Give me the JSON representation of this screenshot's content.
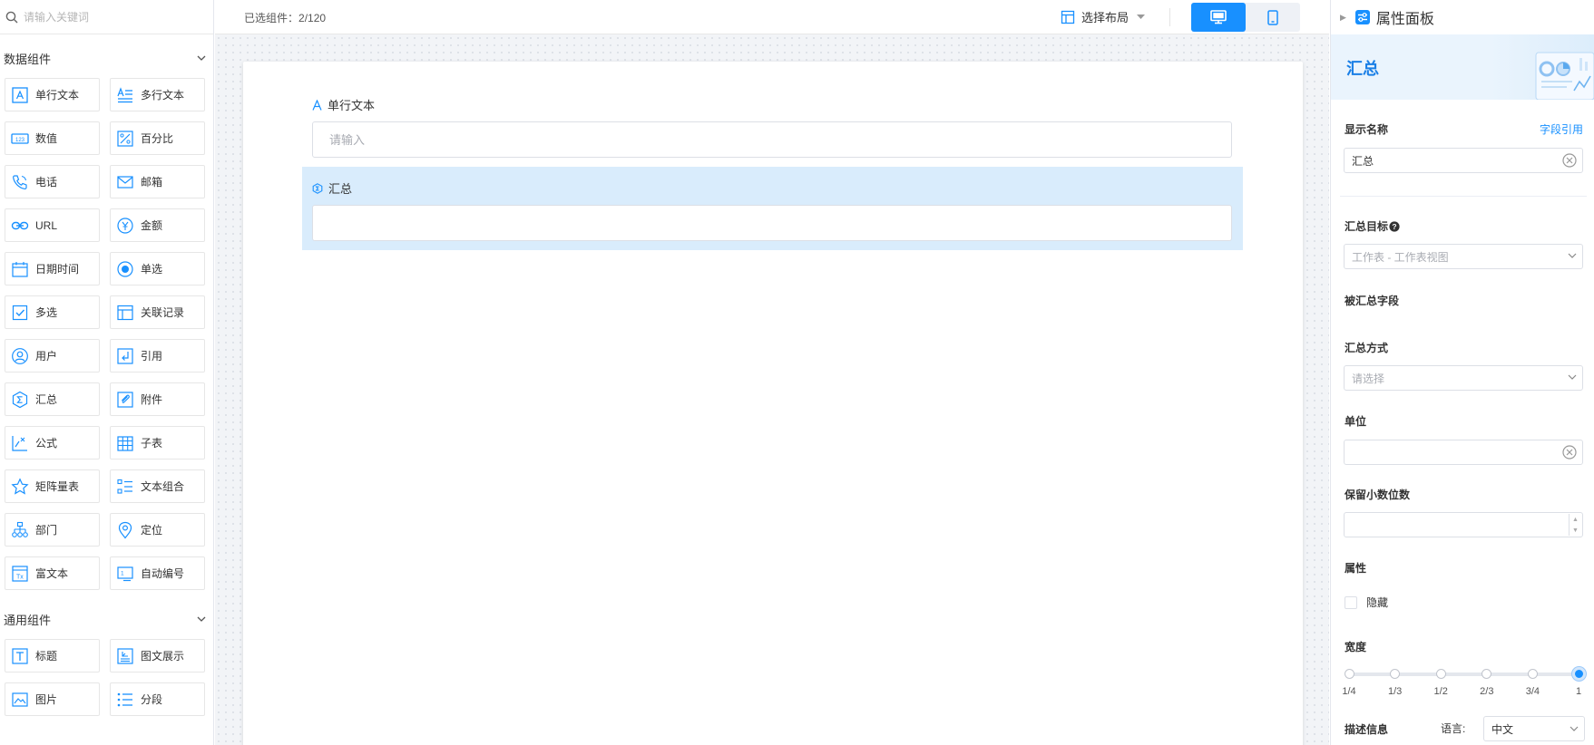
{
  "search": {
    "placeholder": "请输入关键词"
  },
  "groups": {
    "data": {
      "title": "数据组件",
      "items": [
        {
          "label": "单行文本",
          "icon": "single-line-text-icon"
        },
        {
          "label": "多行文本",
          "icon": "multi-line-text-icon"
        },
        {
          "label": "数值",
          "icon": "number-icon"
        },
        {
          "label": "百分比",
          "icon": "percent-icon"
        },
        {
          "label": "电话",
          "icon": "phone-icon"
        },
        {
          "label": "邮箱",
          "icon": "email-icon"
        },
        {
          "label": "URL",
          "icon": "link-icon"
        },
        {
          "label": "金额",
          "icon": "currency-icon"
        },
        {
          "label": "日期时间",
          "icon": "calendar-icon"
        },
        {
          "label": "单选",
          "icon": "radio-icon"
        },
        {
          "label": "多选",
          "icon": "checkbox-icon"
        },
        {
          "label": "关联记录",
          "icon": "relation-icon"
        },
        {
          "label": "用户",
          "icon": "user-icon"
        },
        {
          "label": "引用",
          "icon": "reference-icon"
        },
        {
          "label": "汇总",
          "icon": "summary-icon"
        },
        {
          "label": "附件",
          "icon": "attachment-icon"
        },
        {
          "label": "公式",
          "icon": "formula-icon"
        },
        {
          "label": "子表",
          "icon": "subtable-icon"
        },
        {
          "label": "矩阵量表",
          "icon": "matrix-scale-icon"
        },
        {
          "label": "文本组合",
          "icon": "text-group-icon"
        },
        {
          "label": "部门",
          "icon": "department-icon"
        },
        {
          "label": "定位",
          "icon": "location-icon"
        },
        {
          "label": "富文本",
          "icon": "rich-text-icon"
        },
        {
          "label": "自动编号",
          "icon": "auto-number-icon"
        }
      ]
    },
    "general": {
      "title": "通用组件",
      "items": [
        {
          "label": "标题",
          "icon": "title-icon"
        },
        {
          "label": "图文展示",
          "icon": "image-text-icon"
        },
        {
          "label": "图片",
          "icon": "image-icon"
        },
        {
          "label": "分段",
          "icon": "section-icon"
        }
      ]
    }
  },
  "toolbar": {
    "selected_label": "已选组件：",
    "selected_count": "2/120",
    "layout_label": "选择布局"
  },
  "canvas": {
    "fields": [
      {
        "label": "单行文本",
        "placeholder": "请输入",
        "value": ""
      },
      {
        "label": "汇总",
        "placeholder": "",
        "value": ""
      }
    ]
  },
  "panel": {
    "title": "属性面板",
    "banner_title": "汇总",
    "display_name_label": "显示名称",
    "field_ref_link": "字段引用",
    "display_name_value": "汇总",
    "summary_target_label": "汇总目标",
    "summary_target_value": "工作表 - 工作表视图",
    "summarized_field_label": "被汇总字段",
    "summary_method_label": "汇总方式",
    "summary_method_placeholder": "请选择",
    "unit_label": "单位",
    "unit_value": "",
    "decimals_label": "保留小数位数",
    "decimals_value": "",
    "attribute_label": "属性",
    "hidden_label": "隐藏",
    "hidden_checked": false,
    "width_label": "宽度",
    "width_ticks": [
      "1/4",
      "1/3",
      "1/2",
      "2/3",
      "3/4",
      "1"
    ],
    "width_selected": "1",
    "desc_label": "描述信息",
    "lang_label": "语言:",
    "lang_value": "中文"
  },
  "colors": {
    "accent": "#1890ff",
    "selected_field_bg": "#d9ecfc",
    "canvas_bg": "#f2f4f7"
  }
}
